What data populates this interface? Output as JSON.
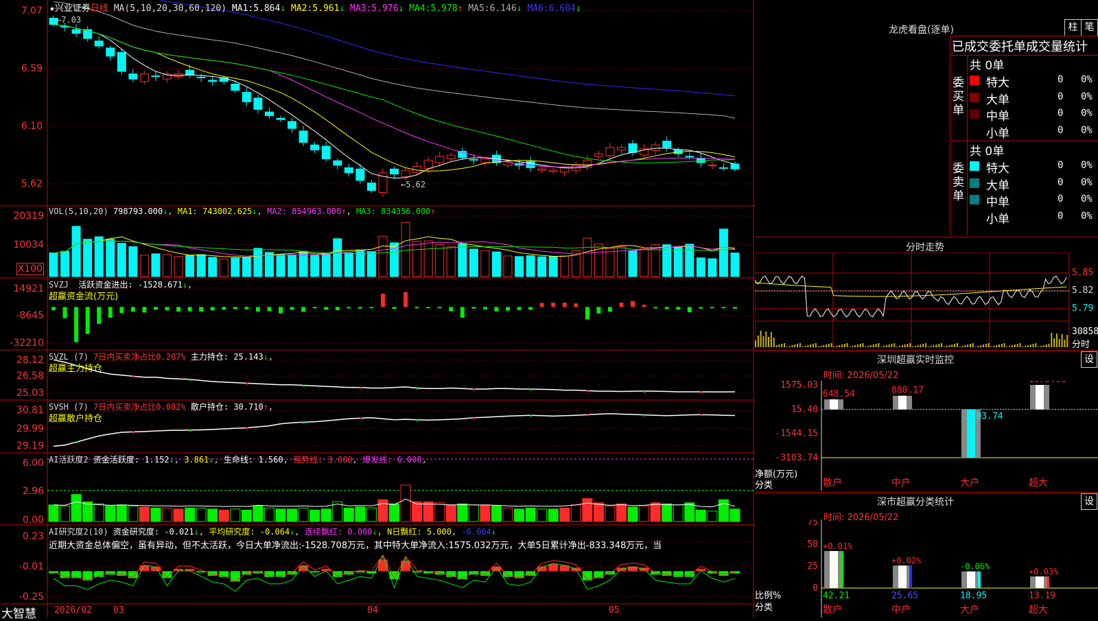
{
  "colors": {
    "up": "#ff2a2a",
    "down": "#00f5f5",
    "green": "#00ee00",
    "yellow": "#ffff00",
    "magenta": "#ff33ff",
    "white": "#ffffff",
    "blue": "#2b2bff",
    "gray": "#b0b0b0",
    "darkred": "#800000",
    "teal": "#008080",
    "grid": "#7a0000",
    "frame": "#cc0000"
  },
  "header": {
    "star": "★",
    "stock_name": "兴业证券",
    "period": "日线",
    "ma_title": "MA(5,10,20,30,60,120)",
    "ma": [
      {
        "label": "MA1:",
        "value": "5.864",
        "arrow": "↓"
      },
      {
        "label": "MA2:",
        "value": "5.961",
        "arrow": "↓"
      },
      {
        "label": "MA3:",
        "value": "5.976",
        "arrow": "↓"
      },
      {
        "label": "MA4:",
        "value": "5.978",
        "arrow": "↑"
      },
      {
        "label": "MA5:",
        "value": "6.146",
        "arrow": "↓"
      },
      {
        "label": "MA6:",
        "value": "6.604",
        "arrow": "↓"
      }
    ],
    "high_mark": "7.03",
    "low_mark": "5.62"
  },
  "panels": {
    "price_axis": [
      "7.07",
      "6.59",
      "6.10",
      "5.62"
    ],
    "vol": {
      "title": "VOL(5,10,20)",
      "value": "798793.000",
      "arrow": "↓",
      "ma": [
        {
          "label": "MA1:",
          "value": "743002.625",
          "arrow": "↓"
        },
        {
          "label": "MA2:",
          "value": "854963.000",
          "arrow": "↑"
        },
        {
          "label": "MA3:",
          "value": "834356.000",
          "arrow": "↑"
        }
      ],
      "axis": [
        "20319",
        "10034"
      ],
      "unit": "X100"
    },
    "svzj": {
      "title": "SVZJ",
      "label": "活跃资金进出:",
      "value": "-1528.671",
      "arrow": "↓",
      "subtitle": "超赢资金流(万元)",
      "axis": [
        "14921",
        "-8645",
        "-32210"
      ]
    },
    "svzl": {
      "title": "SVZL (7)",
      "red_label": "7日内买卖净占比",
      "red_value": "0.207%",
      "label": "主力持仓:",
      "value": "25.143",
      "arrow": "↓",
      "subtitle": "超赢主力持仓",
      "axis": [
        "28.12",
        "26.58",
        "25.03"
      ]
    },
    "svsh": {
      "title": "SVSH (7)",
      "red_label": "7日内买卖净占比",
      "red_value": "0.082%",
      "label": "散户持仓:",
      "value": "30.710",
      "arrow": "↑",
      "subtitle": "超赢散户持仓",
      "axis": [
        "30.81",
        "29.99",
        "29.19"
      ]
    },
    "ai1": {
      "title": "AI活跃度2",
      "label": "资金活跃度:",
      "value": "1.152",
      "arrow": "↓",
      "value2": "3.861",
      "arrow2": "↓",
      "life": "生命线:",
      "life_value": "1.560",
      "strong": "强势线:",
      "strong_value": "3.000",
      "burst": "爆发线:",
      "burst_value": "6.000",
      "axis": [
        "6.00",
        "2.96",
        "0.00"
      ]
    },
    "ai2": {
      "title": "AI研究度2(10)",
      "label": "资金研究度:",
      "value": "-0.021",
      "arrow": "↓",
      "avg": "平均研究度:",
      "avg_value": "-0.064",
      "avg_arrow": "↓",
      "red": "连续飘红:",
      "red_value": "0.000",
      "red_arrow": "↓",
      "nred": "N日飘红:",
      "nred_value": "5.000",
      "nred_value2": "-0.064",
      "nred_arrow": "↓",
      "desc": "近期大资金总体偏空，虽有异动，但不太活跃，今日大单净流出:-1528.708万元，其中特大单净流入:1575.032万元，大单5日累计净出-833.348万元，当",
      "axis": [
        "0.23",
        "-0.01",
        "-0.25"
      ]
    }
  },
  "xaxis": {
    "brand": "大智慧",
    "labels": [
      "2026/02",
      "03",
      "04",
      "05"
    ]
  },
  "right": {
    "lhb": {
      "title": "龙虎看盘(逐单)",
      "btn1": "柱",
      "btn2": "笔",
      "subtitle": "已成交委托单成交量统计",
      "buy": {
        "side": "委买单",
        "total": "共 0单",
        "rows": [
          {
            "name": "特大",
            "count": "0",
            "pct": "0%"
          },
          {
            "name": "大单",
            "count": "0",
            "pct": "0%"
          },
          {
            "name": "中单",
            "count": "0",
            "pct": "0%"
          },
          {
            "name": "小单",
            "count": "0",
            "pct": "0%"
          }
        ]
      },
      "sell": {
        "side": "委卖单",
        "total": "共 0单",
        "rows": [
          {
            "name": "特大",
            "count": "0",
            "pct": "0%"
          },
          {
            "name": "大单",
            "count": "0",
            "pct": "0%"
          },
          {
            "name": "中单",
            "count": "0",
            "pct": "0%"
          },
          {
            "name": "小单",
            "count": "0",
            "pct": "0%"
          }
        ]
      }
    },
    "fenshi": {
      "title": "分时走势",
      "axis": [
        "5.85",
        "5.82",
        "5.79"
      ],
      "vol_label": "30858",
      "unit": "分时"
    },
    "monitor": {
      "title": "深圳超赢实时监控",
      "btn": "设",
      "time": "时间: 2026/05/22",
      "axis": [
        "1575.03",
        "15.40",
        "-1544.15",
        "-3103.74"
      ],
      "ylabel": "净额(万元)",
      "xlabel": "分类"
    },
    "stat": {
      "title": "深市超赢分类统计",
      "btn": "设",
      "time": "时间: 2026/05/22",
      "axis": [
        "75",
        "50",
        "25",
        "0"
      ],
      "ylabel": "比例%",
      "xlabel": "分类"
    }
  },
  "chart_data": [
    {
      "type": "candlestick",
      "title": "兴业证券 日线",
      "series_count": 61,
      "ma_lines": [
        "MA5",
        "MA10",
        "MA20",
        "MA30",
        "MA60",
        "MA120"
      ],
      "ylim": [
        5.55,
        7.12
      ],
      "marks": {
        "high": 7.03,
        "low": 5.62
      },
      "closes": [
        6.97,
        6.95,
        6.9,
        6.86,
        6.8,
        6.72,
        6.6,
        6.54,
        6.58,
        6.56,
        6.58,
        6.58,
        6.57,
        6.55,
        6.52,
        6.52,
        6.45,
        6.36,
        6.3,
        6.25,
        6.22,
        6.15,
        6.04,
        5.98,
        5.91,
        5.86,
        5.8,
        5.74,
        5.66,
        5.8,
        5.79,
        5.82,
        5.85,
        5.9,
        5.93,
        5.94,
        5.92,
        5.9,
        5.91,
        5.88,
        5.89,
        5.86,
        5.84,
        5.83,
        5.82,
        5.84,
        5.86,
        5.9,
        5.95,
        6.0,
        6.0,
        5.96,
        5.99,
        6.02,
        6.0,
        5.95,
        5.93,
        5.88,
        5.86,
        5.84,
        5.83
      ]
    },
    {
      "type": "bar",
      "title": "VOL(5,10,20)",
      "ylim": [
        0,
        22000
      ],
      "values": [
        8600,
        9200,
        18300,
        13600,
        14500,
        13600,
        12100,
        10900,
        7800,
        8300,
        8000,
        7300,
        7700,
        8000,
        7000,
        6400,
        6800,
        7000,
        10300,
        8800,
        8000,
        7900,
        9200,
        7700,
        8400,
        13800,
        8600,
        9700,
        9000,
        14700,
        12300,
        19700,
        12900,
        13000,
        11600,
        10800,
        12000,
        10000,
        9500,
        9000,
        7500,
        7300,
        7600,
        7200,
        7300,
        7500,
        9400,
        14000,
        11900,
        10200,
        10900,
        9400,
        10100,
        11700,
        11600,
        10600,
        11800,
        6800,
        6500,
        17300,
        8600
      ]
    },
    {
      "type": "bar",
      "title": "SVZJ 活跃资金进出",
      "ylim": [
        -34000,
        17000
      ],
      "values": [
        -3000,
        -10200,
        -32000,
        -24500,
        -15300,
        -9800,
        -5500,
        -4300,
        -5000,
        -2500,
        -3100,
        -4200,
        -3800,
        -4100,
        -3200,
        -2500,
        -2000,
        -2100,
        -4200,
        -3800,
        -5700,
        -2600,
        -4400,
        -1100,
        -2500,
        -2900,
        -1300,
        -1500,
        -800,
        12000,
        -1700,
        13500,
        -500,
        -600,
        -700,
        -3800,
        -9800,
        -1500,
        -2100,
        -4000,
        -3300,
        -2900,
        -2700,
        3700,
        3800,
        3900,
        3200,
        -11200,
        -5800,
        -4300,
        3900,
        5400,
        2000,
        -1300,
        -1900,
        -2300,
        -4800,
        -1500,
        -1000,
        -500,
        -1500
      ]
    },
    {
      "type": "line",
      "title": "SVZL 主力持仓",
      "ylim": [
        24.7,
        28.4
      ],
      "values": [
        28.12,
        27.9,
        27.6,
        27.3,
        27.0,
        26.8,
        26.7,
        26.6,
        26.5,
        26.5,
        26.4,
        26.35,
        26.3,
        26.2,
        26.1,
        26.05,
        26.0,
        25.95,
        25.9,
        25.85,
        25.8,
        25.8,
        25.75,
        25.7,
        25.65,
        25.6,
        25.55,
        25.55,
        25.5,
        25.5,
        25.55,
        25.6,
        25.5,
        25.45,
        25.45,
        25.5,
        25.45,
        25.4,
        25.4,
        25.45,
        25.45,
        25.4,
        25.4,
        25.38,
        25.35,
        25.3,
        25.3,
        25.25,
        25.2,
        25.2,
        25.18,
        25.2,
        25.22,
        25.2,
        25.18,
        25.15,
        25.15,
        25.15,
        25.14,
        25.14,
        25.143
      ]
    },
    {
      "type": "line",
      "title": "SVSH 散户持仓",
      "ylim": [
        29.0,
        31.1
      ],
      "values": [
        29.19,
        29.25,
        29.4,
        29.55,
        29.7,
        29.8,
        29.88,
        29.9,
        29.92,
        29.95,
        29.97,
        29.98,
        29.99,
        30.0,
        30.02,
        30.05,
        30.08,
        30.1,
        30.15,
        30.2,
        30.3,
        30.35,
        30.38,
        30.4,
        30.45,
        30.5,
        30.55,
        30.58,
        30.6,
        30.55,
        30.5,
        30.52,
        30.5,
        30.48,
        30.5,
        30.52,
        30.55,
        30.6,
        30.62,
        30.65,
        30.68,
        30.7,
        30.72,
        30.7,
        30.68,
        30.7,
        30.72,
        30.75,
        30.78,
        30.8,
        30.78,
        30.76,
        30.74,
        30.72,
        30.7,
        30.72,
        30.74,
        30.75,
        30.74,
        30.72,
        30.71
      ]
    },
    {
      "type": "bar",
      "title": "AI活跃度2",
      "ylim": [
        0,
        6.2
      ],
      "values": [
        1.6,
        1.5,
        2.6,
        1.9,
        1.7,
        1.5,
        1.6,
        1.5,
        1.4,
        1.3,
        1.3,
        1.2,
        1.3,
        1.3,
        1.2,
        1.1,
        1.2,
        1.1,
        1.5,
        1.3,
        1.2,
        1.2,
        1.3,
        1.1,
        1.2,
        1.9,
        1.3,
        1.4,
        1.3,
        2.1,
        1.7,
        3.5,
        1.9,
        1.9,
        1.8,
        1.6,
        1.7,
        1.6,
        1.6,
        1.5,
        1.3,
        1.2,
        1.3,
        1.2,
        1.2,
        1.3,
        1.6,
        2.2,
        1.8,
        1.5,
        1.7,
        1.4,
        1.5,
        1.8,
        1.7,
        1.6,
        1.8,
        1.1,
        1.0,
        2.1,
        1.2
      ],
      "lines": {
        "strong": 3.0,
        "burst": 6.0,
        "life": 1.56
      }
    },
    {
      "type": "bar",
      "title": "AI研究度2(10)",
      "ylim": [
        -0.27,
        0.25
      ],
      "values": [
        -0.02,
        -0.06,
        -0.06,
        -0.08,
        -0.05,
        -0.03,
        -0.04,
        -0.06,
        0.05,
        0.04,
        -0.06,
        0.02,
        0.02,
        -0.01,
        -0.04,
        -0.05,
        -0.09,
        -0.03,
        -0.02,
        -0.05,
        -0.05,
        -0.03,
        0.05,
        -0.01,
        0.02,
        -0.05,
        -0.03,
        -0.01,
        -0.02,
        0.1,
        -0.07,
        0.09,
        -0.01,
        -0.02,
        -0.03,
        -0.05,
        -0.07,
        -0.03,
        -0.04,
        0.04,
        -0.05,
        -0.06,
        -0.04,
        0.04,
        0.06,
        0.05,
        0.03,
        -0.08,
        -0.06,
        -0.03,
        0.03,
        0.04,
        0.03,
        -0.03,
        -0.04,
        -0.05,
        -0.05,
        0.02,
        -0.02,
        -0.04,
        -0.02
      ]
    },
    {
      "type": "bar",
      "title": "深圳超赢实时监控",
      "categories": [
        "散户",
        "中户",
        "大户",
        "超大"
      ],
      "values": [
        648.54,
        880.17,
        -3103.74,
        1575.03
      ],
      "ylim": [
        -3103.74,
        1575.03
      ]
    },
    {
      "type": "bar",
      "title": "深市超赢分类统计",
      "categories": [
        "散户",
        "中户",
        "大户",
        "超大"
      ],
      "values": [
        42.21,
        25.65,
        18.95,
        13.19
      ],
      "changes": [
        "+0.01%",
        "+0.02%",
        "-0.06%",
        "+0.03%"
      ],
      "ylim": [
        0,
        75
      ]
    }
  ]
}
